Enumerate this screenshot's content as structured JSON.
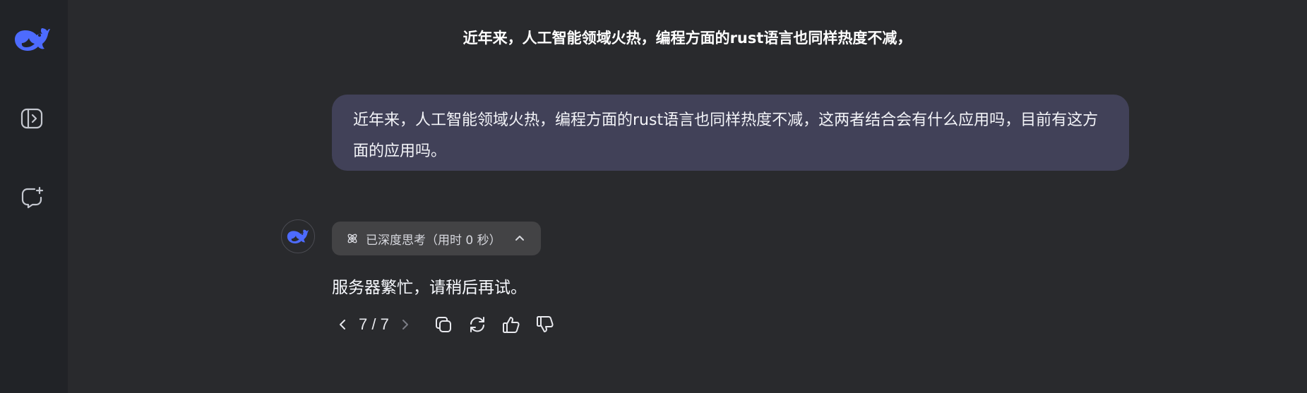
{
  "sidebar": {
    "logo": {
      "icon": "deepseek-whale-logo",
      "color": "#4d6bfe"
    },
    "toggle_icon": "sidebar-open-icon",
    "new_chat_icon": "new-chat-icon"
  },
  "chat": {
    "title": "近年来，人工智能领域火热，编程方面的rust语言也同样热度不减，"
  },
  "user_message": {
    "text": "近年来，人工智能领域火热，编程方面的rust语言也同样热度不减，这两者结合会有什么应用吗，目前有这方面的应用吗。"
  },
  "assistant_message": {
    "avatar_icon": "deepseek-whale-logo",
    "thinking_label": "已深度思考（用时 0 秒）",
    "thinking_icon": "atom-icon",
    "answer": "服务器繁忙，请稍后再试。",
    "pager": "7 / 7",
    "actions": [
      "copy-icon",
      "regenerate-icon",
      "thumbs-up-icon",
      "thumbs-down-icon"
    ]
  },
  "colors": {
    "background": "#292a2d",
    "sidebar": "#212327",
    "user_bubble": "#414158",
    "thinking_pill": "#434345",
    "brand": "#4d6bfe"
  }
}
